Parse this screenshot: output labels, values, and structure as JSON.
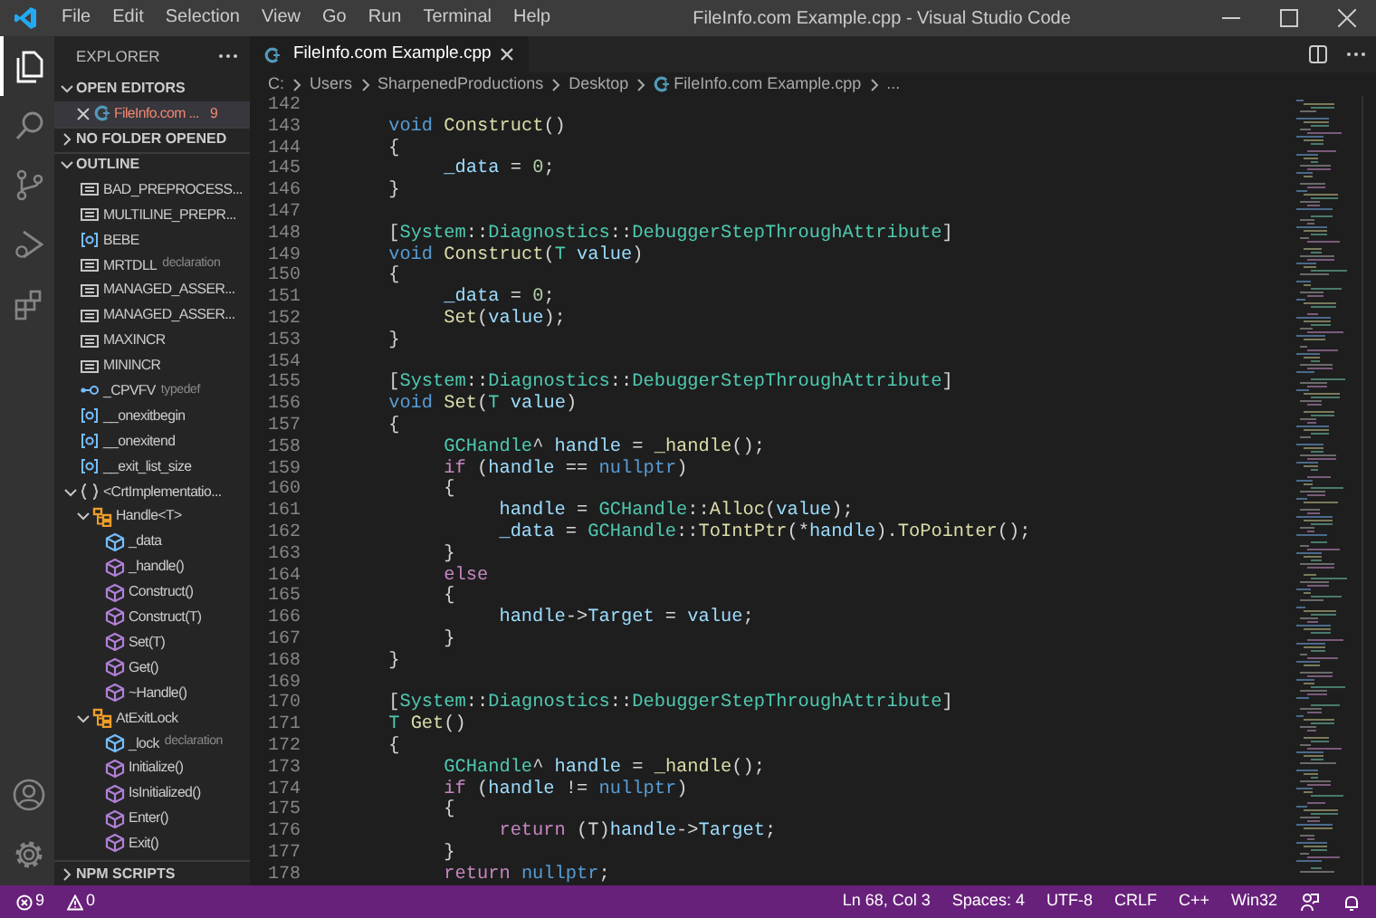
{
  "window": {
    "title": "FileInfo.com Example.cpp - Visual Studio Code"
  },
  "menu": [
    "File",
    "Edit",
    "Selection",
    "View",
    "Go",
    "Run",
    "Terminal",
    "Help"
  ],
  "activity_bar": [
    {
      "kind": "explorer",
      "selected": true
    },
    {
      "kind": "search",
      "selected": false
    },
    {
      "kind": "source-control",
      "selected": false
    },
    {
      "kind": "run",
      "selected": false
    },
    {
      "kind": "extensions",
      "selected": false
    }
  ],
  "activity_bar_bottom": [
    {
      "kind": "account"
    },
    {
      "kind": "settings"
    }
  ],
  "sidebar": {
    "title": "EXPLORER",
    "sections": [
      {
        "title": "OPEN EDITORS",
        "expanded": true,
        "kind": "open_editors",
        "items": [
          {
            "label": "FileInfo.com ...",
            "badge": "9",
            "has_errors": true
          }
        ]
      },
      {
        "title": "NO FOLDER OPENED",
        "expanded": false,
        "kind": "folder"
      },
      {
        "title": "OUTLINE",
        "expanded": true,
        "kind": "outline",
        "tree": [
          {
            "label": "BAD_PREPROCESS...",
            "kind": "macro"
          },
          {
            "label": "MULTILINE_PREPR...",
            "kind": "macro"
          },
          {
            "label": "BEBE",
            "kind": "variable"
          },
          {
            "label": "MRTDLL",
            "detail": "declaration",
            "kind": "macro"
          },
          {
            "label": "MANAGED_ASSER...",
            "kind": "macro"
          },
          {
            "label": "MANAGED_ASSER...",
            "kind": "macro"
          },
          {
            "label": "MAXINCR",
            "kind": "macro"
          },
          {
            "label": "MININCR",
            "kind": "macro"
          },
          {
            "label": "_CPVFV",
            "detail": "typedef",
            "kind": "typedef"
          },
          {
            "label": "__onexitbegin",
            "kind": "variable"
          },
          {
            "label": "__onexitend",
            "kind": "variable"
          },
          {
            "label": "__exit_list_size",
            "kind": "variable"
          },
          {
            "label": "<CrtImplementatio...",
            "kind": "namespace",
            "expanded": true,
            "children": [
              {
                "label": "Handle<T>",
                "kind": "class",
                "expanded": true,
                "children": [
                  {
                    "label": "_data",
                    "kind": "field"
                  },
                  {
                    "label": "_handle()",
                    "kind": "method"
                  },
                  {
                    "label": "Construct()",
                    "kind": "method"
                  },
                  {
                    "label": "Construct(T)",
                    "kind": "method"
                  },
                  {
                    "label": "Set(T)",
                    "kind": "method"
                  },
                  {
                    "label": "Get()",
                    "kind": "method"
                  },
                  {
                    "label": "~Handle()",
                    "kind": "method"
                  }
                ]
              },
              {
                "label": "AtExitLock",
                "kind": "class",
                "expanded": true,
                "children": [
                  {
                    "label": "_lock",
                    "detail": "declaration",
                    "kind": "field"
                  },
                  {
                    "label": "Initialize()",
                    "kind": "method"
                  },
                  {
                    "label": "IsInitialized()",
                    "kind": "method"
                  },
                  {
                    "label": "Enter()",
                    "kind": "method"
                  },
                  {
                    "label": "Exit()",
                    "kind": "method"
                  }
                ]
              }
            ]
          }
        ]
      },
      {
        "title": "NPM SCRIPTS",
        "expanded": false,
        "kind": "npm"
      }
    ]
  },
  "editor": {
    "tabs": [
      {
        "label": "FileInfo.com Example.cpp",
        "selected": true
      }
    ],
    "breadcrumb": [
      {
        "text": "C:",
        "kind": "folder"
      },
      {
        "text": "Users",
        "kind": "folder"
      },
      {
        "text": "SharpenedProductions",
        "kind": "folder"
      },
      {
        "text": "Desktop",
        "kind": "folder"
      },
      {
        "text": "FileInfo.com Example.cpp",
        "kind": "file"
      },
      {
        "text": "...",
        "kind": "more"
      }
    ],
    "lines": [
      {
        "number": "142"
      },
      {
        "number": "143",
        "code": [
          {
            "text": "\tvoid",
            "kind": "kw"
          },
          {
            "text": " Construct",
            "kind": "fn"
          },
          {
            "text": "()",
            "kind": "p"
          }
        ]
      },
      {
        "number": "144",
        "code": [
          {
            "text": "\t{",
            "kind": "p"
          }
        ]
      },
      {
        "number": "145",
        "code": [
          {
            "text": "\t\t_data",
            "kind": "var"
          },
          {
            "text": " = ",
            "kind": "p"
          },
          {
            "text": "0",
            "kind": "num"
          },
          {
            "text": ";",
            "kind": "p"
          }
        ]
      },
      {
        "number": "146",
        "code": [
          {
            "text": "\t}",
            "kind": "p"
          }
        ]
      },
      {
        "number": "147"
      },
      {
        "number": "148",
        "code": [
          {
            "text": "\t[",
            "kind": "p"
          },
          {
            "text": "System",
            "kind": "type"
          },
          {
            "text": "::",
            "kind": "p"
          },
          {
            "text": "Diagnostics",
            "kind": "type"
          },
          {
            "text": "::",
            "kind": "p"
          },
          {
            "text": "DebuggerStepThroughAttribute",
            "kind": "type"
          },
          {
            "text": "]",
            "kind": "p"
          }
        ]
      },
      {
        "number": "149",
        "code": [
          {
            "text": "\tvoid",
            "kind": "kw"
          },
          {
            "text": " Construct",
            "kind": "fn"
          },
          {
            "text": "(",
            "kind": "p"
          },
          {
            "text": "T",
            "kind": "type"
          },
          {
            "text": " value",
            "kind": "var"
          },
          {
            "text": ")",
            "kind": "p"
          }
        ]
      },
      {
        "number": "150",
        "code": [
          {
            "text": "\t{",
            "kind": "p"
          }
        ]
      },
      {
        "number": "151",
        "code": [
          {
            "text": "\t\t_data",
            "kind": "var"
          },
          {
            "text": " = ",
            "kind": "p"
          },
          {
            "text": "0",
            "kind": "num"
          },
          {
            "text": ";",
            "kind": "p"
          }
        ]
      },
      {
        "number": "152",
        "code": [
          {
            "text": "\t\tSet",
            "kind": "fn"
          },
          {
            "text": "(",
            "kind": "p"
          },
          {
            "text": "value",
            "kind": "var"
          },
          {
            "text": ");",
            "kind": "p"
          }
        ]
      },
      {
        "number": "153",
        "code": [
          {
            "text": "\t}",
            "kind": "p"
          }
        ]
      },
      {
        "number": "154"
      },
      {
        "number": "155",
        "code": [
          {
            "text": "\t[",
            "kind": "p"
          },
          {
            "text": "System",
            "kind": "type"
          },
          {
            "text": "::",
            "kind": "p"
          },
          {
            "text": "Diagnostics",
            "kind": "type"
          },
          {
            "text": "::",
            "kind": "p"
          },
          {
            "text": "DebuggerStepThroughAttribute",
            "kind": "type"
          },
          {
            "text": "]",
            "kind": "p"
          }
        ]
      },
      {
        "number": "156",
        "code": [
          {
            "text": "\tvoid",
            "kind": "kw"
          },
          {
            "text": " Set",
            "kind": "fn"
          },
          {
            "text": "(",
            "kind": "p"
          },
          {
            "text": "T",
            "kind": "type"
          },
          {
            "text": " value",
            "kind": "var"
          },
          {
            "text": ")",
            "kind": "p"
          }
        ]
      },
      {
        "number": "157",
        "code": [
          {
            "text": "\t{",
            "kind": "p"
          }
        ]
      },
      {
        "number": "158",
        "code": [
          {
            "text": "\t\tGCHandle",
            "kind": "type"
          },
          {
            "text": "^ ",
            "kind": "p"
          },
          {
            "text": "handle",
            "kind": "var"
          },
          {
            "text": " = ",
            "kind": "p"
          },
          {
            "text": "_handle",
            "kind": "fn"
          },
          {
            "text": "();",
            "kind": "p"
          }
        ]
      },
      {
        "number": "159",
        "code": [
          {
            "text": "\t\tif",
            "kind": "ctrl"
          },
          {
            "text": " (",
            "kind": "p"
          },
          {
            "text": "handle",
            "kind": "var"
          },
          {
            "text": " == ",
            "kind": "p"
          },
          {
            "text": "nullptr",
            "kind": "kw"
          },
          {
            "text": ")",
            "kind": "p"
          }
        ]
      },
      {
        "number": "160",
        "code": [
          {
            "text": "\t\t{",
            "kind": "p"
          }
        ]
      },
      {
        "number": "161",
        "code": [
          {
            "text": "\t\t\thandle",
            "kind": "var"
          },
          {
            "text": " = ",
            "kind": "p"
          },
          {
            "text": "GCHandle",
            "kind": "type"
          },
          {
            "text": "::",
            "kind": "p"
          },
          {
            "text": "Alloc",
            "kind": "fn"
          },
          {
            "text": "(",
            "kind": "p"
          },
          {
            "text": "value",
            "kind": "var"
          },
          {
            "text": ");",
            "kind": "p"
          }
        ]
      },
      {
        "number": "162",
        "code": [
          {
            "text": "\t\t\t_data",
            "kind": "var"
          },
          {
            "text": " = ",
            "kind": "p"
          },
          {
            "text": "GCHandle",
            "kind": "type"
          },
          {
            "text": "::",
            "kind": "p"
          },
          {
            "text": "ToIntPtr",
            "kind": "fn"
          },
          {
            "text": "(*",
            "kind": "p"
          },
          {
            "text": "handle",
            "kind": "var"
          },
          {
            "text": ").",
            "kind": "p"
          },
          {
            "text": "ToPointer",
            "kind": "fn"
          },
          {
            "text": "();",
            "kind": "p"
          }
        ]
      },
      {
        "number": "163",
        "code": [
          {
            "text": "\t\t}",
            "kind": "p"
          }
        ]
      },
      {
        "number": "164",
        "code": [
          {
            "text": "\t\telse",
            "kind": "ctrl"
          }
        ]
      },
      {
        "number": "165",
        "code": [
          {
            "text": "\t\t{",
            "kind": "p"
          }
        ]
      },
      {
        "number": "166",
        "code": [
          {
            "text": "\t\t\thandle",
            "kind": "var"
          },
          {
            "text": "->",
            "kind": "p"
          },
          {
            "text": "Target",
            "kind": "var"
          },
          {
            "text": " = ",
            "kind": "p"
          },
          {
            "text": "value",
            "kind": "var"
          },
          {
            "text": ";",
            "kind": "p"
          }
        ]
      },
      {
        "number": "167",
        "code": [
          {
            "text": "\t\t}",
            "kind": "p"
          }
        ]
      },
      {
        "number": "168",
        "code": [
          {
            "text": "\t}",
            "kind": "p"
          }
        ]
      },
      {
        "number": "169"
      },
      {
        "number": "170",
        "code": [
          {
            "text": "\t[",
            "kind": "p"
          },
          {
            "text": "System",
            "kind": "type"
          },
          {
            "text": "::",
            "kind": "p"
          },
          {
            "text": "Diagnostics",
            "kind": "type"
          },
          {
            "text": "::",
            "kind": "p"
          },
          {
            "text": "DebuggerStepThroughAttribute",
            "kind": "type"
          },
          {
            "text": "]",
            "kind": "p"
          }
        ]
      },
      {
        "number": "171",
        "code": [
          {
            "text": "\tT",
            "kind": "type"
          },
          {
            "text": " Get",
            "kind": "fn"
          },
          {
            "text": "()",
            "kind": "p"
          }
        ]
      },
      {
        "number": "172",
        "code": [
          {
            "text": "\t{",
            "kind": "p"
          }
        ]
      },
      {
        "number": "173",
        "code": [
          {
            "text": "\t\tGCHandle",
            "kind": "type"
          },
          {
            "text": "^ ",
            "kind": "p"
          },
          {
            "text": "handle",
            "kind": "var"
          },
          {
            "text": " = ",
            "kind": "p"
          },
          {
            "text": "_handle",
            "kind": "fn"
          },
          {
            "text": "();",
            "kind": "p"
          }
        ]
      },
      {
        "number": "174",
        "code": [
          {
            "text": "\t\tif",
            "kind": "ctrl"
          },
          {
            "text": " (",
            "kind": "p"
          },
          {
            "text": "handle",
            "kind": "var"
          },
          {
            "text": " != ",
            "kind": "p"
          },
          {
            "text": "nullptr",
            "kind": "kw"
          },
          {
            "text": ")",
            "kind": "p"
          }
        ]
      },
      {
        "number": "175",
        "code": [
          {
            "text": "\t\t{",
            "kind": "p"
          }
        ]
      },
      {
        "number": "176",
        "code": [
          {
            "text": "\t\t\treturn",
            "kind": "ctrl"
          },
          {
            "text": " (T)",
            "kind": "p"
          },
          {
            "text": "handle",
            "kind": "var"
          },
          {
            "text": "->",
            "kind": "p"
          },
          {
            "text": "Target",
            "kind": "var"
          },
          {
            "text": ";",
            "kind": "p"
          }
        ]
      },
      {
        "number": "177",
        "code": [
          {
            "text": "\t\t}",
            "kind": "p"
          }
        ]
      },
      {
        "number": "178",
        "code": [
          {
            "text": "\t\treturn",
            "kind": "ctrl"
          },
          {
            "text": " nullptr",
            "kind": "kw"
          },
          {
            "text": ";",
            "kind": "p"
          }
        ]
      }
    ]
  },
  "status_bar": {
    "left": [
      {
        "kind": "errors",
        "text": "9"
      },
      {
        "kind": "warnings",
        "text": "0"
      }
    ],
    "right": [
      {
        "kind": "text",
        "text": "Ln 68, Col 3"
      },
      {
        "kind": "text",
        "text": "Spaces: 4"
      },
      {
        "kind": "text",
        "text": "UTF-8"
      },
      {
        "kind": "text",
        "text": "CRLF"
      },
      {
        "kind": "text",
        "text": "C++"
      },
      {
        "kind": "text",
        "text": "Win32"
      },
      {
        "kind": "feedback"
      },
      {
        "kind": "bell"
      }
    ]
  }
}
